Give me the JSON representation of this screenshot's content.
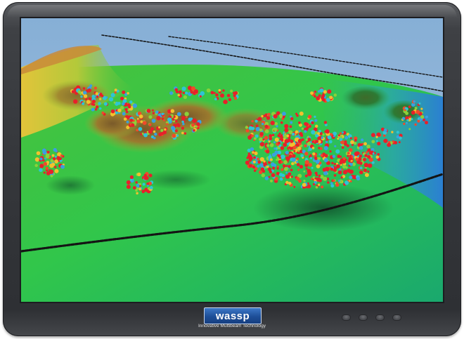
{
  "device": {
    "brand_logo": "wassp",
    "tagline": "Innovative Multibeam Technology",
    "bezel_color": "#3a3c40"
  },
  "display": {
    "scene": "3d-seafloor-bathymetry",
    "icons": [
      "vessel-track-line",
      "fish-target-dots",
      "seafloor-terrain"
    ],
    "colors": {
      "sky": "#7aa6cf",
      "deep_blue": "#2f8fd6",
      "mid_green": "#2ec24a",
      "shallow_yellow": "#d8c43a",
      "peak_brown": "#6b4a26",
      "target_red": "#e8202a",
      "track_black": "#141414"
    }
  },
  "buttons": [
    "button-1",
    "button-2",
    "button-3",
    "button-4"
  ]
}
